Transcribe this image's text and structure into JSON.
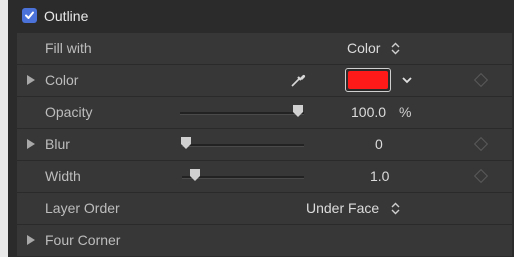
{
  "header": {
    "label": "Outline",
    "checked": true
  },
  "rows": {
    "fill_with": {
      "label": "Fill with",
      "value": "Color"
    },
    "color": {
      "label": "Color",
      "swatch": "#ff1a1a"
    },
    "opacity": {
      "label": "Opacity",
      "value": "100.0",
      "unit": "%",
      "level": 1.0
    },
    "blur": {
      "label": "Blur",
      "value": "0",
      "level": 0.0
    },
    "width": {
      "label": "Width",
      "value": "1.0",
      "level": 0.08
    },
    "layer_order": {
      "label": "Layer Order",
      "value": "Under Face"
    },
    "four_corner": {
      "label": "Four Corner"
    }
  },
  "colors": {
    "accent": "#4a72d8",
    "panel": "#2b2b2b",
    "row": "#373737"
  },
  "icons": [
    "checkbox-icon",
    "disclosure-triangle-icon",
    "eyedropper-icon",
    "chevron-down-icon",
    "updown-arrows-icon",
    "keyframe-diamond-icon"
  ]
}
